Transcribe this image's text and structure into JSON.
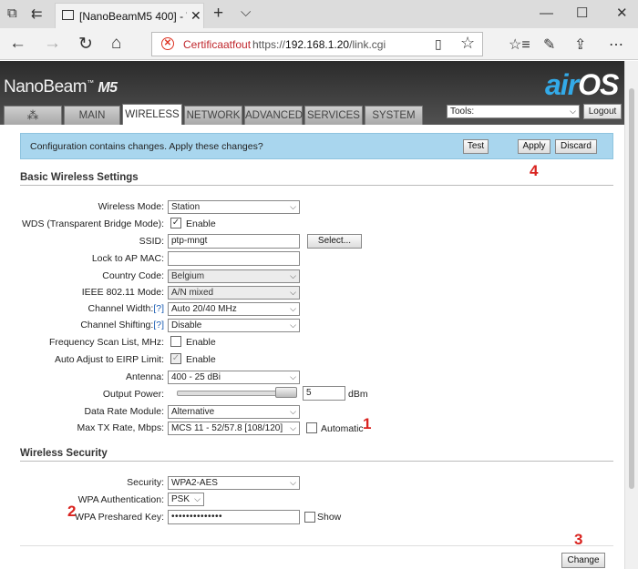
{
  "browser": {
    "tab_title": "[NanoBeamM5 400] - W",
    "cert_warning": "Certificaatfout",
    "url_prefix": "https://",
    "url_host": "192.168.1.20",
    "url_path": "/link.cgi"
  },
  "header": {
    "brand": "NanoBeam",
    "brand_model": "M5",
    "logo_air": "air",
    "logo_os": "OS",
    "tabs": [
      "MAIN",
      "WIRELESS",
      "NETWORK",
      "ADVANCED",
      "SERVICES",
      "SYSTEM"
    ],
    "active_tab": "WIRELESS",
    "tools_label": "Tools:",
    "logout": "Logout"
  },
  "notice": {
    "text": "Configuration contains changes. Apply these changes?",
    "test": "Test",
    "apply": "Apply",
    "discard": "Discard"
  },
  "basic": {
    "title": "Basic Wireless Settings",
    "wireless_mode_label": "Wireless Mode:",
    "wireless_mode": "Station",
    "wds_label": "WDS (Transparent Bridge Mode):",
    "wds_enable": "Enable",
    "ssid_label": "SSID:",
    "ssid": "ptp-mngt",
    "select_btn": "Select...",
    "lock_label": "Lock to AP MAC:",
    "lock_mac": "",
    "country_label": "Country Code:",
    "country": "Belgium",
    "ieee_label": "IEEE 802.11 Mode:",
    "ieee": "A/N mixed",
    "width_label": "Channel Width:",
    "width_help": "[?]",
    "width": "Auto 20/40 MHz",
    "shift_label": "Channel Shifting:",
    "shift_help": "[?]",
    "shift": "Disable",
    "freq_label": "Frequency Scan List, MHz:",
    "freq_enable": "Enable",
    "eirp_label": "Auto Adjust to EIRP Limit:",
    "eirp_enable": "Enable",
    "antenna_label": "Antenna:",
    "antenna": "400 - 25 dBi",
    "power_label": "Output Power:",
    "power": "5",
    "power_unit": "dBm",
    "rate_module_label": "Data Rate Module:",
    "rate_module": "Alternative",
    "max_tx_label": "Max TX Rate, Mbps:",
    "max_tx": "MCS 11 - 52/57.8 [108/120]",
    "automatic": "Automatic"
  },
  "security": {
    "title": "Wireless Security",
    "security_label": "Security:",
    "security": "WPA2-AES",
    "auth_label": "WPA Authentication:",
    "auth": "PSK",
    "key_label": "WPA Preshared Key:",
    "key": "••••••••••••••",
    "show": "Show"
  },
  "change_btn": "Change",
  "annotations": [
    "1",
    "2",
    "3",
    "4"
  ],
  "colors": {
    "notice_bg": "#a9d6ee",
    "annotation": "#d9231f",
    "logo_os": "#33aae8"
  }
}
